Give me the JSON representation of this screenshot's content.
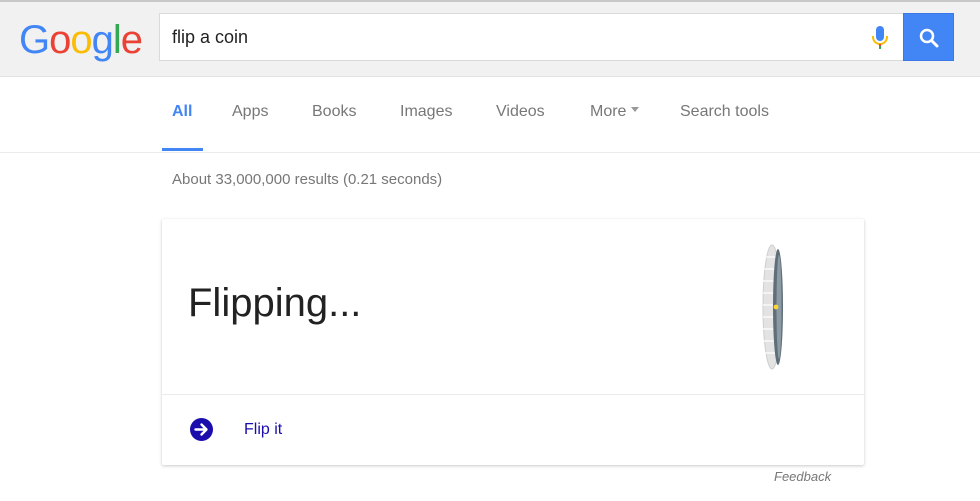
{
  "logo": {
    "letters": [
      "G",
      "o",
      "o",
      "g",
      "l",
      "e"
    ],
    "colors": [
      "#4285f4",
      "#ea4335",
      "#fbbc05",
      "#4285f4",
      "#34a853",
      "#ea4335"
    ]
  },
  "search": {
    "query": "flip a coin",
    "mic_icon": "microphone-icon",
    "button_icon": "search-icon",
    "accent": "#4285f4"
  },
  "tabs": [
    {
      "label": "All",
      "active": true
    },
    {
      "label": "Apps",
      "active": false
    },
    {
      "label": "Books",
      "active": false
    },
    {
      "label": "Images",
      "active": false
    },
    {
      "label": "Videos",
      "active": false
    },
    {
      "label": "More",
      "active": false
    },
    {
      "label": "Search tools",
      "active": false
    }
  ],
  "results": {
    "stats": "About 33,000,000 results (0.21 seconds)"
  },
  "coin_card": {
    "status": "Flipping...",
    "coin_icon": "coin-icon",
    "action_label": "Flip it",
    "action_icon": "arrow-right-circle-icon",
    "link_color": "#1a0dab"
  },
  "feedback": "Feedback"
}
